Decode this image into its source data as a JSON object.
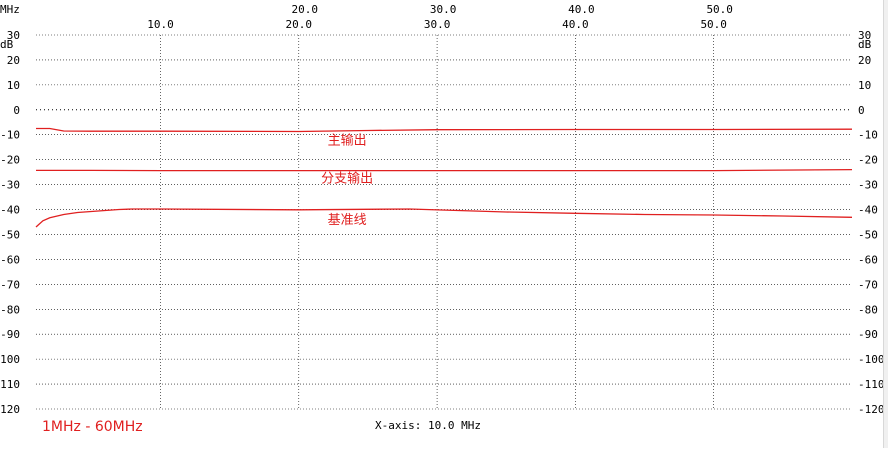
{
  "chart_data": {
    "type": "line",
    "x_unit": "MHz",
    "y_unit": "dB",
    "xlim": [
      1,
      60
    ],
    "ylim": [
      -120,
      30
    ],
    "x_ticks_top": [
      "10.0",
      "20.0",
      "30.0",
      "40.0",
      "50.0"
    ],
    "x_ticks_bottom": [
      "20.0",
      "30.0",
      "40.0",
      "50.0"
    ],
    "x_tick_values_top": [
      10,
      20,
      30,
      40,
      50
    ],
    "y_ticks": [
      30,
      20,
      10,
      0,
      -10,
      -20,
      -30,
      -40,
      -50,
      -60,
      -70,
      -80,
      -90,
      -100,
      -110,
      -120
    ],
    "reference_level": 0,
    "grid": "vertical and horizontal dashed lines at 10 MHz / 10 dB",
    "x_axis_note": "X-axis: 10.0 MHz",
    "range_label": "1MHz - 60MHz",
    "colors": {
      "trace": "#e02020",
      "text": "#000000",
      "range_label": "#e02020",
      "grid": "#000000"
    },
    "series": [
      {
        "name": "主输出",
        "x": [
          1,
          2,
          3,
          5,
          10,
          20,
          25,
          30,
          40,
          50,
          60
        ],
        "y": [
          -7.5,
          -7.5,
          -8.5,
          -8.6,
          -8.6,
          -8.7,
          -8.3,
          -8.0,
          -7.9,
          -7.9,
          -7.8
        ]
      },
      {
        "name": "分支输出",
        "x": [
          1,
          5,
          10,
          20,
          30,
          40,
          50,
          60
        ],
        "y": [
          -24.3,
          -24.3,
          -24.4,
          -24.4,
          -24.4,
          -24.4,
          -24.4,
          -24.0
        ]
      },
      {
        "name": "基准线",
        "x": [
          1,
          1.5,
          2,
          3,
          4,
          5,
          6,
          7,
          8,
          10,
          20,
          28,
          35,
          40,
          45,
          50,
          55,
          60
        ],
        "y": [
          -47,
          -44.5,
          -43.3,
          -42,
          -41.2,
          -40.8,
          -40.4,
          -40,
          -39.8,
          -39.8,
          -40.1,
          -39.8,
          -41,
          -41.5,
          -42,
          -42.2,
          -42.6,
          -43.1
        ]
      }
    ]
  }
}
